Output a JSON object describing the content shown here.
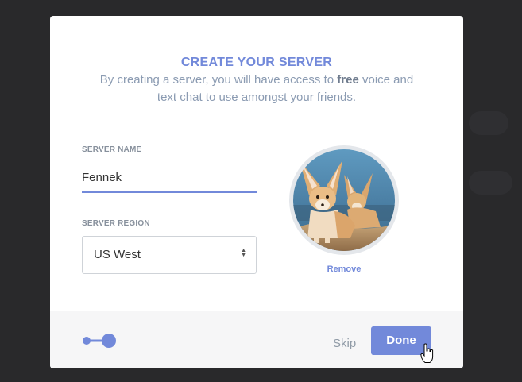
{
  "dialog": {
    "title": "CREATE YOUR SERVER",
    "subtitle_before": "By creating a server, you will have access to ",
    "subtitle_bold": "free",
    "subtitle_after": " voice and text chat to use amongst your friends."
  },
  "form": {
    "server_name_label": "SERVER NAME",
    "server_name_value": "Fennek",
    "server_region_label": "SERVER REGION",
    "server_region_value": "US West"
  },
  "avatar": {
    "remove_label": "Remove"
  },
  "footer": {
    "skip_label": "Skip",
    "done_label": "Done",
    "progress_step": 2,
    "progress_total": 2
  },
  "colors": {
    "accent": "#7289da",
    "backdrop": "#29292b",
    "footer_bg": "#f6f6f7"
  }
}
